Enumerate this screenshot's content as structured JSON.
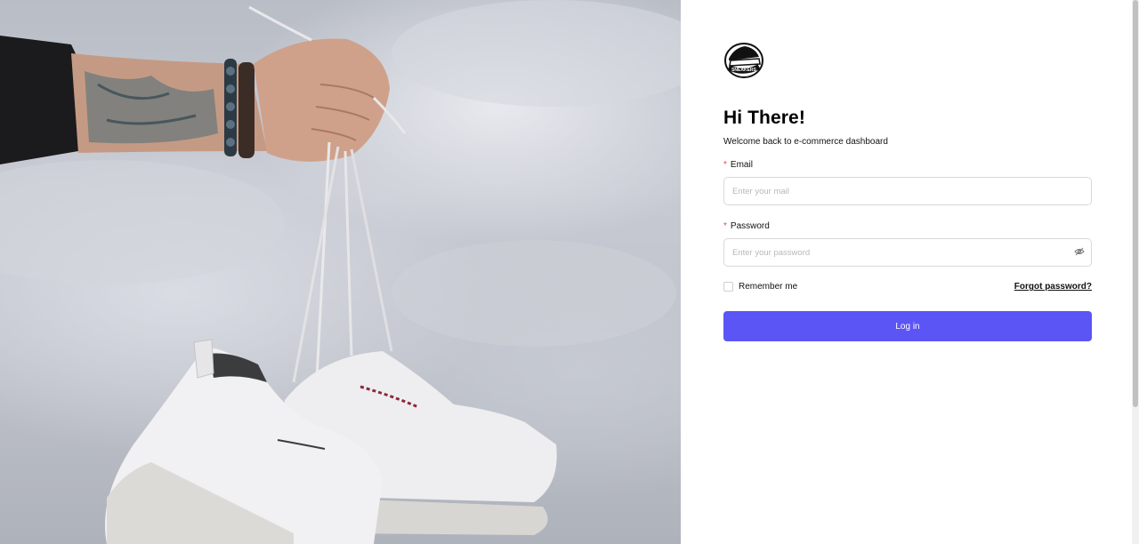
{
  "hero": {
    "image_description_icon": "sneakers-photo"
  },
  "brand": {
    "logo_text": "SNEAKERS",
    "accent_color": "#5b55f6"
  },
  "login": {
    "title": "Hi There!",
    "subtitle": "Welcome back to e-commerce dashboard",
    "email": {
      "required_mark": "*",
      "label": "Email",
      "placeholder": "Enter your mail",
      "value": ""
    },
    "password": {
      "required_mark": "*",
      "label": "Password",
      "placeholder": "Enter your password",
      "value": "",
      "toggle_icon": "eye-off-icon"
    },
    "remember_label": "Remember me",
    "remember_checked": false,
    "forgot_label": "Forgot password?",
    "submit_label": "Log in"
  }
}
